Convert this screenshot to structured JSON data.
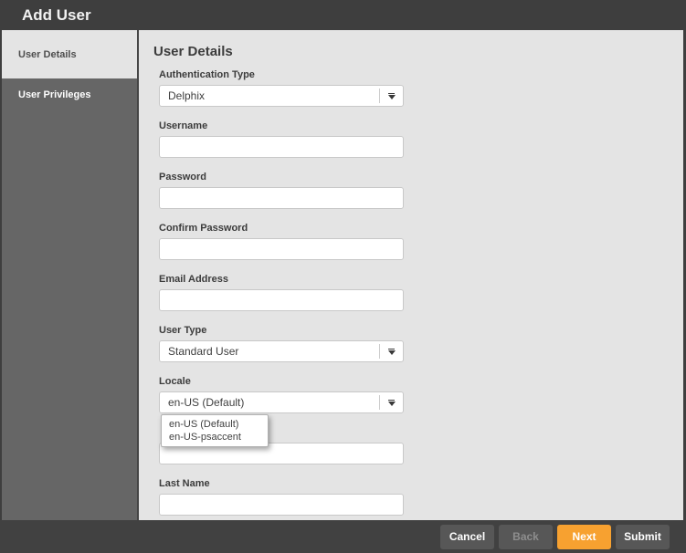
{
  "colors": {
    "header_bg": "#3e3e3e",
    "sidebar_bg": "#666666",
    "content_bg": "#e4e4e4",
    "footer_bg": "#414141",
    "button_gray": "#575757",
    "accent_orange": "#f7a130",
    "disabled_text": "#8e8e8e"
  },
  "window": {
    "title": "Add User"
  },
  "sidebar": {
    "tabs": [
      {
        "label": "User Details",
        "active": true
      },
      {
        "label": "User Privileges",
        "active": false
      }
    ]
  },
  "form": {
    "heading": "User Details",
    "fields": [
      {
        "type": "select",
        "label": "Authentication Type",
        "value": "Delphix"
      },
      {
        "type": "text",
        "label": "Username",
        "value": ""
      },
      {
        "type": "text",
        "label": "Password",
        "value": ""
      },
      {
        "type": "text",
        "label": "Confirm Password",
        "value": ""
      },
      {
        "type": "text",
        "label": "Email Address",
        "value": ""
      },
      {
        "type": "select",
        "label": "User Type",
        "value": "Standard User"
      },
      {
        "type": "select",
        "label": "Locale",
        "value": "en-US (Default)",
        "dropdown_open": true,
        "options": [
          "en-US (Default)",
          "en-US-psaccent"
        ]
      },
      {
        "type": "text",
        "label": "",
        "value": ""
      },
      {
        "type": "text",
        "label": "Last Name",
        "value": ""
      }
    ]
  },
  "footer": {
    "buttons": [
      {
        "label": "Cancel",
        "style": "gray",
        "enabled": true
      },
      {
        "label": "Back",
        "style": "gray",
        "enabled": false
      },
      {
        "label": "Next",
        "style": "orange",
        "enabled": true
      },
      {
        "label": "Submit",
        "style": "gray",
        "enabled": true
      }
    ]
  }
}
